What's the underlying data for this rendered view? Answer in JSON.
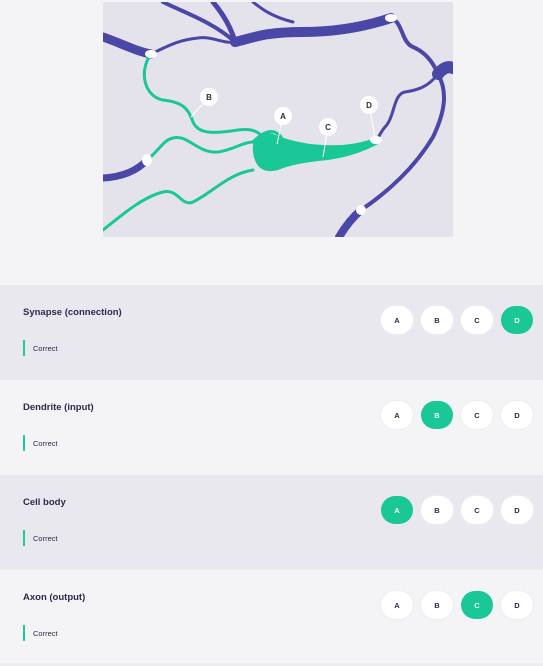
{
  "diagram": {
    "labels": [
      "A",
      "B",
      "C",
      "D"
    ],
    "colors": {
      "neuron_teal": "#19c797",
      "neighbor_purple": "#4a47a6",
      "background": "#e4e3ec"
    }
  },
  "questions": [
    {
      "title": "Synapse (connection)",
      "feedback": "Correct",
      "options": [
        "A",
        "B",
        "C",
        "D"
      ],
      "selected": "D"
    },
    {
      "title": "Dendrite (input)",
      "feedback": "Correct",
      "options": [
        "A",
        "B",
        "C",
        "D"
      ],
      "selected": "B"
    },
    {
      "title": "Cell body",
      "feedback": "Correct",
      "options": [
        "A",
        "B",
        "C",
        "D"
      ],
      "selected": "A"
    },
    {
      "title": "Axon (output)",
      "feedback": "Correct",
      "options": [
        "A",
        "B",
        "C",
        "D"
      ],
      "selected": "C"
    }
  ],
  "colors": {
    "accent": "#19c797",
    "text": "#2a2b4a",
    "row_shade": "#e9e8ef"
  }
}
